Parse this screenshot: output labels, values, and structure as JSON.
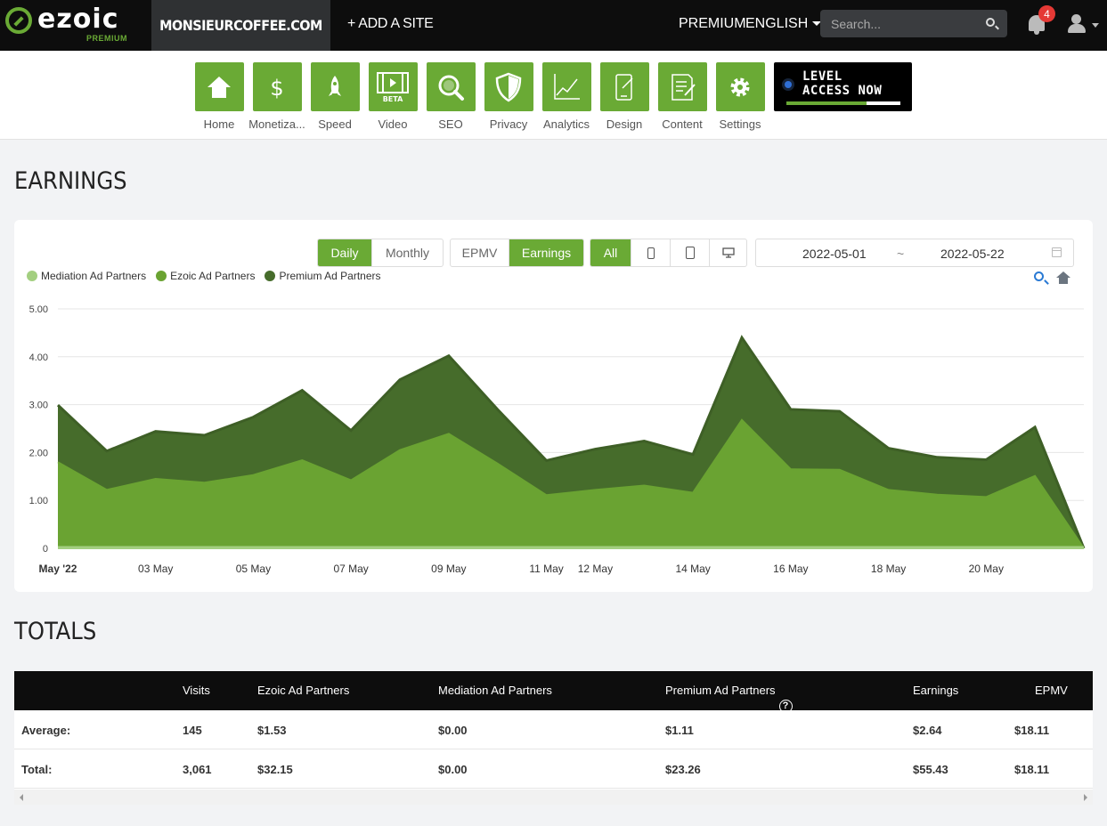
{
  "topnav": {
    "logo_text": "ezoic",
    "logo_badge": "PREMIUM",
    "site_name": "MONSIEURCOFFEE.COM",
    "add_site": "+ ADD A SITE",
    "premium": "PREMIUM",
    "language": "ENGLISH",
    "search_placeholder": "Search...",
    "notification_count": "4"
  },
  "menu": {
    "items": [
      {
        "label": "Home",
        "icon": "home-icon"
      },
      {
        "label": "Monetiza...",
        "icon": "dollar-icon"
      },
      {
        "label": "Speed",
        "icon": "rocket-icon"
      },
      {
        "label": "Video",
        "icon": "video-icon",
        "badge": "BETA"
      },
      {
        "label": "SEO",
        "icon": "magnifier-icon"
      },
      {
        "label": "Privacy",
        "icon": "shield-icon"
      },
      {
        "label": "Analytics",
        "icon": "line-chart-icon"
      },
      {
        "label": "Design",
        "icon": "design-icon"
      },
      {
        "label": "Content",
        "icon": "content-icon"
      },
      {
        "label": "Settings",
        "icon": "gear-icon"
      }
    ],
    "level_line1": "LEVEL",
    "level_line2": "ACCESS NOW",
    "level_progress": 0.7
  },
  "earnings": {
    "title": "EARNINGS",
    "period_buttons": [
      "Daily",
      "Monthly"
    ],
    "period_active": "Daily",
    "metric_buttons": [
      "EPMV",
      "Earnings"
    ],
    "metric_active": "Earnings",
    "device_all": "All",
    "date_from": "2022-05-01",
    "date_sep": "~",
    "date_to": "2022-05-22"
  },
  "chart_data": {
    "type": "area",
    "stacked": true,
    "legend_position": "top-left",
    "grid": true,
    "ylim": [
      0,
      5
    ],
    "yticks": [
      "0",
      "1.00",
      "2.00",
      "3.00",
      "4.00",
      "5.00"
    ],
    "x": [
      "2022-05-01",
      "2022-05-02",
      "2022-05-03",
      "2022-05-04",
      "2022-05-05",
      "2022-05-06",
      "2022-05-07",
      "2022-05-08",
      "2022-05-09",
      "2022-05-10",
      "2022-05-11",
      "2022-05-12",
      "2022-05-13",
      "2022-05-14",
      "2022-05-15",
      "2022-05-16",
      "2022-05-17",
      "2022-05-18",
      "2022-05-19",
      "2022-05-20",
      "2022-05-21",
      "2022-05-22"
    ],
    "xticks": [
      {
        "i": 0,
        "label": "May '22"
      },
      {
        "i": 2,
        "label": "03 May"
      },
      {
        "i": 4,
        "label": "05 May"
      },
      {
        "i": 6,
        "label": "07 May"
      },
      {
        "i": 8,
        "label": "09 May"
      },
      {
        "i": 10,
        "label": "11 May"
      },
      {
        "i": 11,
        "label": "12 May"
      },
      {
        "i": 13,
        "label": "14 May"
      },
      {
        "i": 15,
        "label": "16 May"
      },
      {
        "i": 17,
        "label": "18 May"
      },
      {
        "i": 19,
        "label": "20 May"
      }
    ],
    "series": [
      {
        "name": "Mediation Ad Partners",
        "color": "#a3cf80",
        "values": [
          0,
          0,
          0,
          0,
          0,
          0,
          0,
          0,
          0,
          0,
          0,
          0,
          0,
          0,
          0,
          0,
          0,
          0,
          0,
          0,
          0,
          0
        ]
      },
      {
        "name": "Ezoic Ad Partners",
        "color": "#6aa332",
        "values": [
          1.8,
          1.22,
          1.45,
          1.37,
          1.53,
          1.84,
          1.42,
          2.05,
          2.39,
          1.77,
          1.11,
          1.22,
          1.31,
          1.16,
          2.68,
          1.65,
          1.64,
          1.22,
          1.12,
          1.07,
          1.51,
          0
        ]
      },
      {
        "name": "Premium Ad Partners",
        "color": "#466c2b",
        "values": [
          1.19,
          0.81,
          0.99,
          0.99,
          1.21,
          1.46,
          1.04,
          1.47,
          1.63,
          1.13,
          0.72,
          0.85,
          0.93,
          0.8,
          1.72,
          1.25,
          1.22,
          0.87,
          0.78,
          0.78,
          1.02,
          0
        ]
      }
    ]
  },
  "totals": {
    "title": "TOTALS",
    "columns": [
      "",
      "Visits",
      "Ezoic Ad Partners",
      "Mediation Ad Partners",
      "Premium Ad Partners",
      "Earnings",
      "EPMV"
    ],
    "rows": [
      [
        "Average:",
        "145",
        "$1.53",
        "$0.00",
        "$1.11",
        "$2.64",
        "$18.11"
      ],
      [
        "Total:",
        "3,061",
        "$32.15",
        "$0.00",
        "$23.26",
        "$55.43",
        "$18.11"
      ]
    ]
  }
}
